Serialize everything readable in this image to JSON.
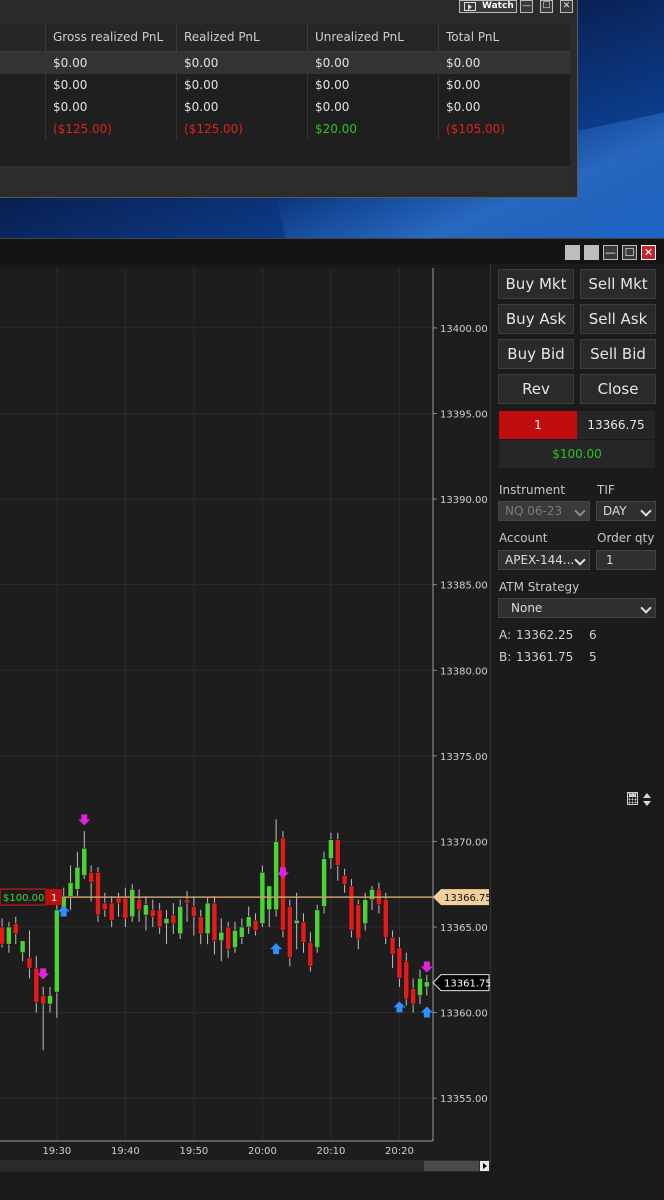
{
  "pnl_window": {
    "watch_label": "Watch",
    "columns": [
      "Gross realized PnL",
      "Realized PnL",
      "Unrealized PnL",
      "Total PnL"
    ],
    "rows": [
      {
        "gross": "$0.00",
        "realized": "$0.00",
        "unrealized": "$0.00",
        "total": "$0.00"
      },
      {
        "gross": "$0.00",
        "realized": "$0.00",
        "unrealized": "$0.00",
        "total": "$0.00"
      },
      {
        "gross": "$0.00",
        "realized": "$0.00",
        "unrealized": "$0.00",
        "total": "$0.00"
      },
      {
        "gross": "($125.00)",
        "realized": "($125.00)",
        "unrealized": "$20.00",
        "total": "($105.00)"
      }
    ]
  },
  "chart_trader": {
    "buttons": {
      "buy_mkt": "Buy Mkt",
      "sell_mkt": "Sell Mkt",
      "buy_ask": "Buy Ask",
      "sell_ask": "Sell Ask",
      "buy_bid": "Buy Bid",
      "sell_bid": "Sell Bid",
      "rev": "Rev",
      "close": "Close"
    },
    "position": {
      "qty": "1",
      "avg_price": "13366.75",
      "pnl": "$100.00"
    },
    "labels": {
      "instrument": "Instrument",
      "tif": "TIF",
      "account": "Account",
      "order_qty": "Order qty",
      "atm_strategy": "ATM Strategy"
    },
    "instrument": "NQ 06-23",
    "tif": "DAY",
    "account": "APEX-144...",
    "order_qty": "1",
    "atm_strategy": "None",
    "ask": {
      "label": "A:",
      "price": "13362.25",
      "size": "6"
    },
    "bid": {
      "label": "B:",
      "price": "13361.75",
      "size": "5"
    }
  },
  "chart_data": {
    "type": "candlestick",
    "instrument": "NQ 06-23",
    "interval_minutes": 1,
    "y_ticks": [
      13355.0,
      13360.0,
      13365.0,
      13370.0,
      13375.0,
      13380.0,
      13385.0,
      13390.0,
      13395.0,
      13400.0
    ],
    "y_tick_labels": [
      "13355.00",
      "13360.00",
      "13365.00",
      "13370.00",
      "13375.00",
      "13380.00",
      "13385.00",
      "13390.00",
      "13395.00",
      "13400.00"
    ],
    "ylim": [
      13352.5,
      13403.5
    ],
    "x_tick_labels": [
      "19:30",
      "19:40",
      "19:50",
      "20:00",
      "20:10",
      "20:20"
    ],
    "x_tick_minutes": [
      1170,
      1180,
      1190,
      1200,
      1210,
      1220
    ],
    "x_range_minutes": [
      1161.7,
      1224.9
    ],
    "position_line": {
      "price": 13366.75,
      "label": "13366.75",
      "pnl_label": "$100.00",
      "qty_label": "1"
    },
    "last_price": {
      "price": 13361.75,
      "label": "13361.75"
    },
    "colors": {
      "up": "#4cd137",
      "down": "#e21b1b",
      "position_line": "#c8a06a",
      "grid": "#2c2c2c"
    },
    "candles": [
      {
        "t": 1162,
        "o": 13365.0,
        "h": 13365.5,
        "c": 13364.0,
        "l": 13363.8
      },
      {
        "t": 1163,
        "o": 13364.0,
        "h": 13365.3,
        "c": 13365.0,
        "l": 13363.5
      },
      {
        "t": 1164,
        "o": 13365.2,
        "h": 13365.6,
        "c": 13364.6,
        "l": 13364.0
      },
      {
        "t": 1165,
        "o": 13363.5,
        "h": 13364.2,
        "c": 13364.2,
        "l": 13363.0
      },
      {
        "t": 1166,
        "o": 13363.2,
        "h": 13364.8,
        "c": 13362.6,
        "l": 13362.0
      },
      {
        "t": 1167,
        "o": 13362.6,
        "h": 13363.3,
        "c": 13360.6,
        "l": 13360.0
      },
      {
        "t": 1168,
        "o": 13361.0,
        "h": 13361.5,
        "c": 13360.5,
        "l": 13357.8
      },
      {
        "t": 1169,
        "o": 13360.5,
        "h": 13361.5,
        "c": 13361.0,
        "l": 13360.0
      },
      {
        "t": 1170,
        "o": 13361.2,
        "h": 13366.3,
        "c": 13366.0,
        "l": 13359.7
      },
      {
        "t": 1171,
        "o": 13366.0,
        "h": 13367.3,
        "c": 13366.8,
        "l": 13365.8
      },
      {
        "t": 1172,
        "o": 13366.8,
        "h": 13368.6,
        "c": 13367.6,
        "l": 13366.0
      },
      {
        "t": 1173,
        "o": 13367.2,
        "h": 13369.4,
        "c": 13368.5,
        "l": 13366.8
      },
      {
        "t": 1174,
        "o": 13368.0,
        "h": 13370.6,
        "c": 13369.6,
        "l": 13367.8
      },
      {
        "t": 1175,
        "o": 13368.2,
        "h": 13368.6,
        "c": 13367.6,
        "l": 13366.5
      },
      {
        "t": 1176,
        "o": 13368.2,
        "h": 13368.5,
        "c": 13365.7,
        "l": 13365.3
      },
      {
        "t": 1177,
        "o": 13366.4,
        "h": 13367.0,
        "c": 13366.0,
        "l": 13365.6
      },
      {
        "t": 1178,
        "o": 13366.4,
        "h": 13366.8,
        "c": 13365.4,
        "l": 13365.0
      },
      {
        "t": 1179,
        "o": 13366.7,
        "h": 13367.0,
        "c": 13366.4,
        "l": 13365.6
      },
      {
        "t": 1180,
        "o": 13366.7,
        "h": 13367.3,
        "c": 13365.5,
        "l": 13365.0
      },
      {
        "t": 1181,
        "o": 13365.6,
        "h": 13367.5,
        "c": 13367.2,
        "l": 13365.3
      },
      {
        "t": 1182,
        "o": 13366.6,
        "h": 13367.2,
        "c": 13366.0,
        "l": 13365.3
      },
      {
        "t": 1183,
        "o": 13365.7,
        "h": 13366.8,
        "c": 13366.3,
        "l": 13364.8
      },
      {
        "t": 1184,
        "o": 13366.0,
        "h": 13366.6,
        "c": 13365.6,
        "l": 13365.0
      },
      {
        "t": 1185,
        "o": 13366.0,
        "h": 13366.4,
        "c": 13365.0,
        "l": 13364.6
      },
      {
        "t": 1186,
        "o": 13365.2,
        "h": 13366.0,
        "c": 13365.5,
        "l": 13364.0
      },
      {
        "t": 1187,
        "o": 13365.7,
        "h": 13366.4,
        "c": 13365.2,
        "l": 13364.6
      },
      {
        "t": 1188,
        "o": 13364.6,
        "h": 13366.6,
        "c": 13366.2,
        "l": 13364.3
      },
      {
        "t": 1189,
        "o": 13366.6,
        "h": 13367.1,
        "c": 13366.4,
        "l": 13365.3
      },
      {
        "t": 1190,
        "o": 13366.2,
        "h": 13366.8,
        "c": 13365.6,
        "l": 13364.5
      },
      {
        "t": 1191,
        "o": 13365.6,
        "h": 13366.0,
        "c": 13364.6,
        "l": 13364.0
      },
      {
        "t": 1192,
        "o": 13364.6,
        "h": 13366.7,
        "c": 13366.4,
        "l": 13364.0
      },
      {
        "t": 1193,
        "o": 13366.4,
        "h": 13366.8,
        "c": 13364.2,
        "l": 13363.4
      },
      {
        "t": 1194,
        "o": 13364.2,
        "h": 13365.5,
        "c": 13364.7,
        "l": 13363.0
      },
      {
        "t": 1195,
        "o": 13365.0,
        "h": 13365.3,
        "c": 13363.7,
        "l": 13363.2
      },
      {
        "t": 1196,
        "o": 13363.8,
        "h": 13365.3,
        "c": 13364.8,
        "l": 13363.5
      },
      {
        "t": 1197,
        "o": 13364.4,
        "h": 13365.5,
        "c": 13365.0,
        "l": 13364.0
      },
      {
        "t": 1198,
        "o": 13365.0,
        "h": 13366.2,
        "c": 13365.6,
        "l": 13364.6
      },
      {
        "t": 1199,
        "o": 13365.4,
        "h": 13365.8,
        "c": 13364.8,
        "l": 13364.5
      },
      {
        "t": 1200,
        "o": 13365.2,
        "h": 13368.6,
        "c": 13368.2,
        "l": 13365.0
      },
      {
        "t": 1201,
        "o": 13366.0,
        "h": 13366.6,
        "c": 13367.4,
        "l": 13365.0
      },
      {
        "t": 1202,
        "o": 13366.0,
        "h": 13371.3,
        "c": 13370.0,
        "l": 13365.6
      },
      {
        "t": 1203,
        "o": 13370.2,
        "h": 13370.6,
        "c": 13364.8,
        "l": 13364.4
      },
      {
        "t": 1204,
        "o": 13366.2,
        "h": 13366.6,
        "c": 13363.2,
        "l": 13362.7
      },
      {
        "t": 1205,
        "o": 13365.2,
        "h": 13367.0,
        "c": 13365.4,
        "l": 13363.7
      },
      {
        "t": 1206,
        "o": 13365.3,
        "h": 13365.8,
        "c": 13364.1,
        "l": 13363.5
      },
      {
        "t": 1207,
        "o": 13364.1,
        "h": 13364.7,
        "c": 13362.7,
        "l": 13362.4
      },
      {
        "t": 1208,
        "o": 13363.8,
        "h": 13366.3,
        "c": 13366.0,
        "l": 13363.5
      },
      {
        "t": 1209,
        "o": 13366.2,
        "h": 13369.4,
        "c": 13369.0,
        "l": 13365.8
      },
      {
        "t": 1210,
        "o": 13369.0,
        "h": 13370.5,
        "c": 13370.1,
        "l": 13368.4
      },
      {
        "t": 1211,
        "o": 13370.1,
        "h": 13370.5,
        "c": 13368.6,
        "l": 13367.7
      },
      {
        "t": 1212,
        "o": 13368.0,
        "h": 13368.4,
        "c": 13367.5,
        "l": 13367.0
      },
      {
        "t": 1213,
        "o": 13367.4,
        "h": 13367.8,
        "c": 13364.8,
        "l": 13364.4
      },
      {
        "t": 1214,
        "o": 13366.3,
        "h": 13366.6,
        "c": 13364.3,
        "l": 13363.7
      },
      {
        "t": 1215,
        "o": 13365.2,
        "h": 13367.0,
        "c": 13366.6,
        "l": 13364.8
      },
      {
        "t": 1216,
        "o": 13366.6,
        "h": 13367.4,
        "c": 13367.2,
        "l": 13366.0
      },
      {
        "t": 1217,
        "o": 13367.2,
        "h": 13367.6,
        "c": 13366.3,
        "l": 13365.8
      },
      {
        "t": 1218,
        "o": 13366.6,
        "h": 13367.0,
        "c": 13364.4,
        "l": 13364.0
      },
      {
        "t": 1219,
        "o": 13364.4,
        "h": 13364.8,
        "c": 13363.4,
        "l": 13362.6
      },
      {
        "t": 1220,
        "o": 13363.8,
        "h": 13364.4,
        "c": 13362.0,
        "l": 13361.5
      },
      {
        "t": 1221,
        "o": 13363.0,
        "h": 13363.5,
        "c": 13360.8,
        "l": 13360.4
      },
      {
        "t": 1222,
        "o": 13361.4,
        "h": 13362.0,
        "c": 13360.5,
        "l": 13360.0
      },
      {
        "t": 1223,
        "o": 13361.0,
        "h": 13362.5,
        "c": 13362.0,
        "l": 13360.5
      },
      {
        "t": 1224,
        "o": 13361.5,
        "h": 13362.2,
        "c": 13361.8,
        "l": 13361.0
      }
    ]
  }
}
